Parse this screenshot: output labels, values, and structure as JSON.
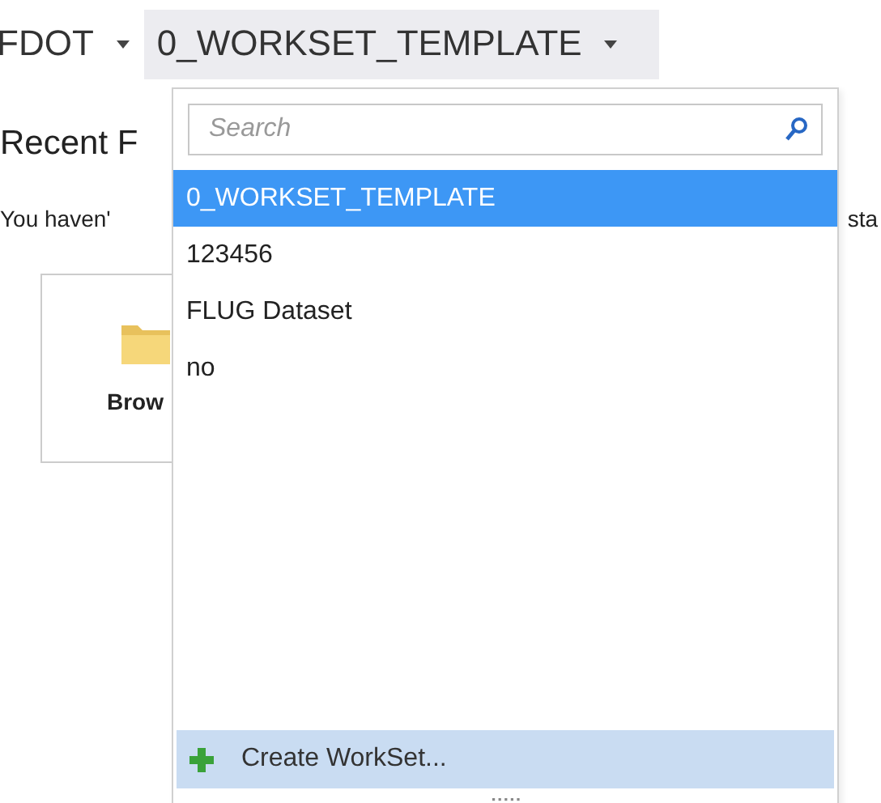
{
  "breadcrumb": {
    "parent": "FDOT",
    "current": "0_WORKSET_TEMPLATE",
    "expanded": true
  },
  "page": {
    "heading": "Recent F",
    "message": "You haven'",
    "message_end": "sta",
    "tile_label": "Brow"
  },
  "dropdown": {
    "search": {
      "placeholder": "Search"
    },
    "items": [
      {
        "label": "0_WORKSET_TEMPLATE",
        "selected": true
      },
      {
        "label": "123456",
        "selected": false
      },
      {
        "label": "FLUG Dataset",
        "selected": false
      },
      {
        "label": "no",
        "selected": false
      }
    ],
    "footer": {
      "label": "Create WorkSet..."
    }
  }
}
